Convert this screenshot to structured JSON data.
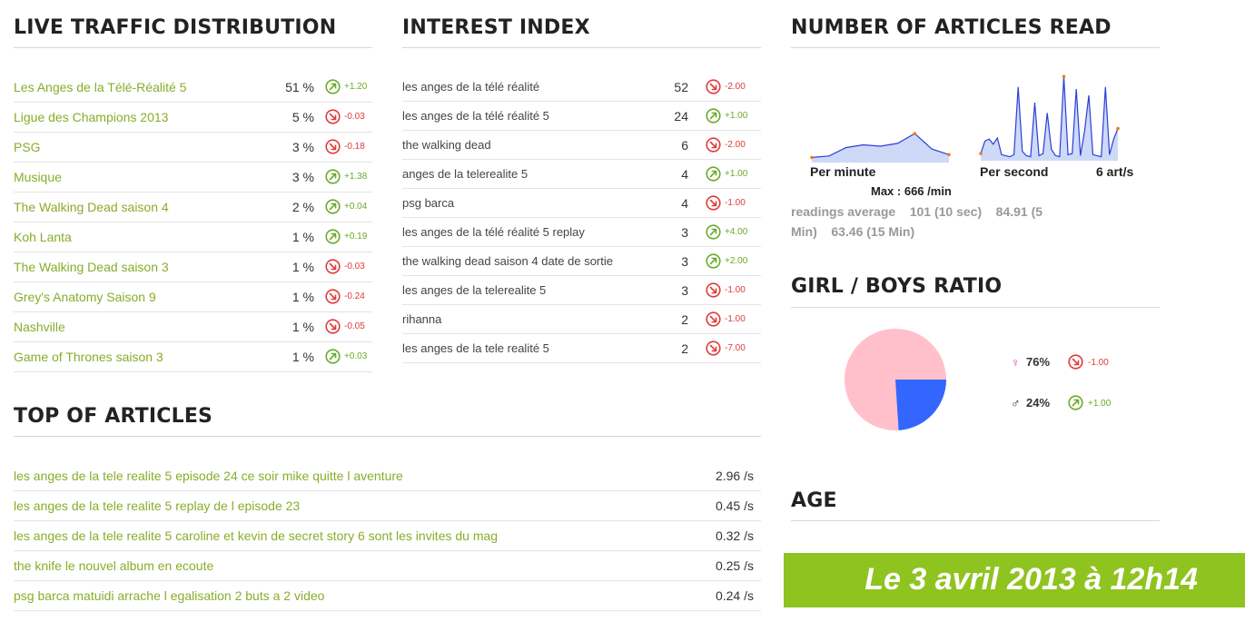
{
  "sections": {
    "traffic_title": "LIVE TRAFFIC DISTRIBUTION",
    "interest_title": "INTEREST INDEX",
    "articles_read_title": "NUMBER OF ARTICLES READ",
    "top_articles_title": "TOP OF ARTICLES",
    "ratio_title": "GIRL / BOYS RATIO",
    "age_title": "AGE"
  },
  "traffic": [
    {
      "label": "Les Anges de la Télé-Réalité 5",
      "value": "51 %",
      "dir": "up",
      "delta": "+1.20"
    },
    {
      "label": "Ligue des Champions 2013",
      "value": "5 %",
      "dir": "down",
      "delta": "-0.03"
    },
    {
      "label": "PSG",
      "value": "3 %",
      "dir": "down",
      "delta": "-0.18"
    },
    {
      "label": "Musique",
      "value": "3 %",
      "dir": "up",
      "delta": "+1.38"
    },
    {
      "label": "The Walking Dead saison 4",
      "value": "2 %",
      "dir": "up",
      "delta": "+0.04"
    },
    {
      "label": "Koh Lanta",
      "value": "1 %",
      "dir": "up",
      "delta": "+0.19"
    },
    {
      "label": "The Walking Dead saison 3",
      "value": "1 %",
      "dir": "down",
      "delta": "-0.03"
    },
    {
      "label": "Grey's Anatomy Saison 9",
      "value": "1 %",
      "dir": "down",
      "delta": "-0.24"
    },
    {
      "label": "Nashville",
      "value": "1 %",
      "dir": "down",
      "delta": "-0.05"
    },
    {
      "label": "Game of Thrones saison 3",
      "value": "1 %",
      "dir": "up",
      "delta": "+0.03"
    }
  ],
  "interest": [
    {
      "label": "les anges de la télé réalité",
      "value": "52",
      "dir": "down",
      "delta": "-2.00"
    },
    {
      "label": "les anges de la télé réalité 5",
      "value": "24",
      "dir": "up",
      "delta": "+1.00"
    },
    {
      "label": "the walking dead",
      "value": "6",
      "dir": "down",
      "delta": "-2.00"
    },
    {
      "label": "anges de la telerealite 5",
      "value": "4",
      "dir": "up",
      "delta": "+1.00"
    },
    {
      "label": "psg barca",
      "value": "4",
      "dir": "down",
      "delta": "-1.00"
    },
    {
      "label": "les anges de la télé réalité 5 replay",
      "value": "3",
      "dir": "up",
      "delta": "+4.00"
    },
    {
      "label": "the walking dead saison 4 date de sortie",
      "value": "3",
      "dir": "up",
      "delta": "+2.00"
    },
    {
      "label": "les anges de la telerealite 5",
      "value": "3",
      "dir": "down",
      "delta": "-1.00"
    },
    {
      "label": "rihanna",
      "value": "2",
      "dir": "down",
      "delta": "-1.00"
    },
    {
      "label": "les anges de la tele realité 5",
      "value": "2",
      "dir": "down",
      "delta": "-7.00"
    }
  ],
  "top_articles": [
    {
      "label": "les anges de la tele realite 5 episode 24 ce soir mike quitte l aventure",
      "value": "2.96 /s"
    },
    {
      "label": "les anges de la tele realite 5 replay de l episode 23",
      "value": "0.45 /s"
    },
    {
      "label": "les anges de la tele realite 5 caroline et kevin de secret story 6 sont les invites du mag",
      "value": "0.32 /s"
    },
    {
      "label": "the knife le nouvel album en ecoute",
      "value": "0.25 /s"
    },
    {
      "label": "psg barca matuidi arrache l egalisation 2 buts a 2 video",
      "value": "0.24 /s"
    }
  ],
  "articles_read": {
    "per_minute_label": "Per minute",
    "per_second_label": "Per second",
    "rate": "6 art/s",
    "max": "Max : 666 /min",
    "readings_line1": "readings average    101 (10 sec)    84.91 (5",
    "readings_line2": "Min)    63.46 (15 Min)"
  },
  "ratio": {
    "girls": {
      "symbol": "♀",
      "value": "76%",
      "dir": "down",
      "delta": "-1.00",
      "color": "#ffc0cb"
    },
    "boys": {
      "symbol": "♂",
      "value": "24%",
      "dir": "up",
      "delta": "+1.00",
      "color": "#3366ff"
    }
  },
  "banner": "Le 3 avril 2013 à 12h14",
  "chart_data": [
    {
      "type": "line",
      "name": "Per minute",
      "values": [
        3,
        4,
        10,
        12,
        11,
        13,
        20,
        9,
        5
      ]
    },
    {
      "type": "line",
      "name": "Per second",
      "values": [
        6,
        18,
        20,
        15,
        21,
        5,
        4,
        3,
        5,
        70,
        8,
        4,
        3,
        55,
        4,
        6,
        45,
        10,
        4,
        3,
        80,
        5,
        6,
        68,
        4,
        28,
        62,
        5,
        4,
        3,
        70,
        5,
        20,
        30
      ]
    },
    {
      "type": "pie",
      "categories": [
        "Girls",
        "Boys"
      ],
      "values": [
        76,
        24
      ]
    }
  ],
  "colors": {
    "up": "#6aaa2a",
    "down": "#e03a3a",
    "link": "#8aac2a",
    "banner": "#8fc31f"
  }
}
